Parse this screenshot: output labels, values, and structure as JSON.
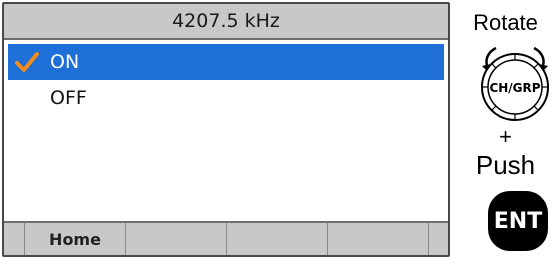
{
  "screen": {
    "title": "4207.5 kHz",
    "items": [
      {
        "label": "ON",
        "selected": true,
        "checked": true
      },
      {
        "label": "OFF",
        "selected": false,
        "checked": false
      }
    ],
    "softkeys": [
      "Home",
      "",
      "",
      ""
    ],
    "colors": {
      "selection": "#1f6fd8",
      "check": "#f28c1e",
      "bars": "#c8c8c8"
    }
  },
  "controls": {
    "rotate_label": "Rotate",
    "knob_label": "CH/GRP",
    "plus_label": "+",
    "push_label": "Push",
    "ent_label": "ENT"
  }
}
